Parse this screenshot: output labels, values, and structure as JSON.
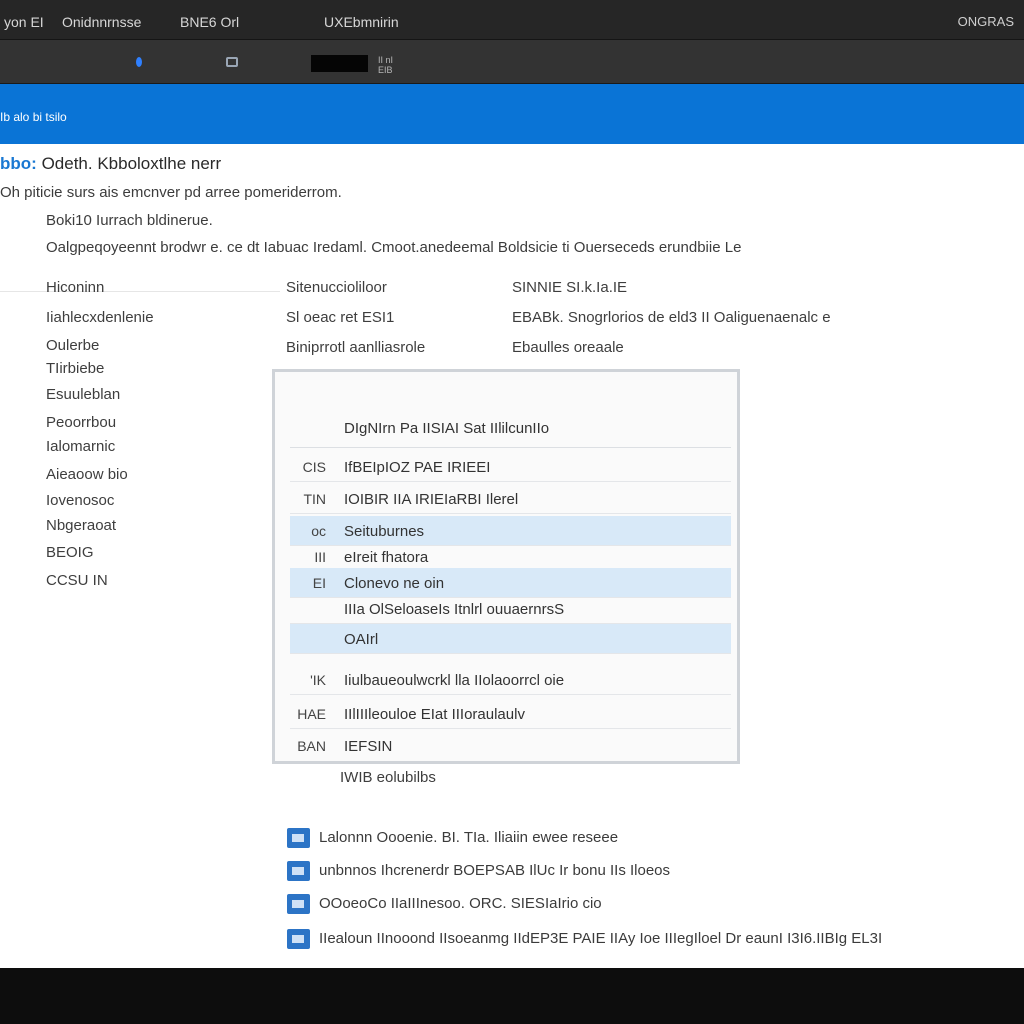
{
  "window": {
    "menu": [
      "yon EI",
      "Onidnnrnsse",
      "BNE6 Orl",
      "UXEbmnirin"
    ],
    "right_label": "ONGRAS"
  },
  "toolbar": {
    "small_text": [
      "II nI",
      "EIB"
    ]
  },
  "header_band": {
    "label": "Ib alo bi tsilo"
  },
  "main": {
    "title_lead": "bbo:",
    "title": "Odeth. Kbboloxtlhe nerr",
    "intro_lines": [
      "Oh   piticie surs ais emcnver pd arree pomeriderrom.",
      "Boki10 Iurrach bldinerue.",
      "Oalgpeqoyeennt brodwr e. ce dt Iabuac Iredaml. Cmoot.anedeemal Boldsicie ti Ouerseceds erundbiie Le"
    ],
    "row1": [
      "Hiconinn",
      "Sitenuccioliloor",
      "SINNIE SI.k.Ia.IE"
    ],
    "row2": [
      "Iiahlecxdenlenie",
      "Sl oeac ret ESI1",
      "EBABk. Snogrlorios de eld3  II Oaliguenaenalc e"
    ],
    "row3": [
      "",
      "Biniprrotl aanlliasrole",
      "Ebaulles oreaale"
    ],
    "side_items": [
      "Oulerbe",
      "TIirbiebe",
      "Esuuleblan",
      "Peoorrbou",
      "Ialomarnic",
      "Aieaoow bio",
      "Iovenosoc",
      "Nbgeraoat",
      "BEOIG",
      "CCSU IN"
    ]
  },
  "dialog": {
    "header": "DIgNIrn Pa IISIAI Sat IIlilcunIIo",
    "rows": [
      {
        "icon": "CIS",
        "text": "IfBEIpIOZ PAE IRIEEI",
        "highlight": false
      },
      {
        "icon": "TIN",
        "text": "IOIBIR IIA IRIEIaRBI Ilerel",
        "highlight": false
      },
      {
        "icon": "oc",
        "text": "Seituburnes",
        "highlight": true
      },
      {
        "icon": "III",
        "text": "eIreit fhatora",
        "highlight": false
      },
      {
        "icon": "EI",
        "text": "Clonevo ne oin",
        "highlight": true
      },
      {
        "icon": "",
        "text": "IIIa OlSeloaseIs Itnlrl ouuaernrsS",
        "highlight": false
      },
      {
        "icon": "",
        "text": "OAIrl",
        "highlight": true
      },
      {
        "icon": "'IK",
        "text": "Iiulbaueoulwcrkl lla IIolaoorrcl oie",
        "highlight": false
      },
      {
        "icon": "HAE",
        "text": "IIlIIIleouloe EIat IIIoraulaulv",
        "highlight": false
      },
      {
        "icon": "BAN",
        "text": "IEFSIN",
        "highlight": false
      }
    ],
    "footer_label": "IWIB eolubilbs"
  },
  "bottom_list": [
    "Lalonnn Oooenie. BI. TIa. Iliaiin ewee reseee",
    "unbnnos Ihcrenerdr BOEPSAB IlUc Ir bonu IIs Iloeos",
    "OOoeoCo IIaIIInesoo. ORC. SIESIaIrio cio",
    "IIealoun IInooond IIsoeanmg IIdEP3E PAIE IIAy Ioe IIIegIloel Dr eaunI I3I6.IIBIg EL3I"
  ],
  "colors": {
    "accent_blue": "#0a74d6",
    "highlight_row": "#d8e9f8",
    "title_bar": "#262626"
  }
}
